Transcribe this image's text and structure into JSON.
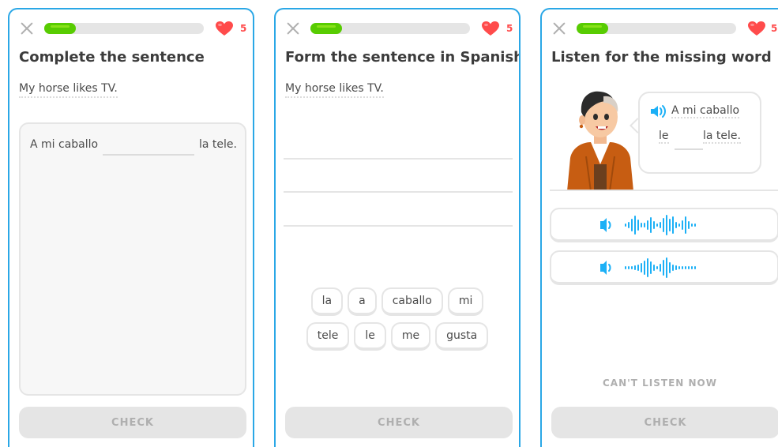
{
  "colors": {
    "accent_blue": "#2aa7e6",
    "progress_green": "#58cc02",
    "heart_red": "#ff4b4b",
    "disabled_gray": "#e5e5e5",
    "speaker_blue": "#1cb0f6"
  },
  "screens": [
    {
      "hearts": "5",
      "progress": 0.2,
      "title": "Complete the sentence",
      "prompt": "My horse likes TV.",
      "answer_before": "A mi caballo",
      "answer_after": "la tele.",
      "check_label": "CHECK",
      "icons": [
        "close-icon",
        "heart-icon"
      ]
    },
    {
      "hearts": "5",
      "progress": 0.2,
      "title": "Form the sentence in Spanish",
      "prompt": "My horse likes TV.",
      "word_bank_row1": [
        "la",
        "a",
        "caballo",
        "mi"
      ],
      "word_bank_row2": [
        "tele",
        "le",
        "me",
        "gusta"
      ],
      "check_label": "CHECK",
      "icons": [
        "close-icon",
        "heart-icon"
      ]
    },
    {
      "hearts": "5",
      "progress": 0.2,
      "title": "Listen for the missing word",
      "bubble_line1": "A mi caballo",
      "bubble_line2_before": "le",
      "bubble_line2_after": "la tele.",
      "cant_listen": "CAN'T LISTEN NOW",
      "check_label": "CHECK",
      "icons": [
        "close-icon",
        "heart-icon",
        "speaker-icon",
        "character-illustration",
        "waveform-icon"
      ]
    }
  ]
}
